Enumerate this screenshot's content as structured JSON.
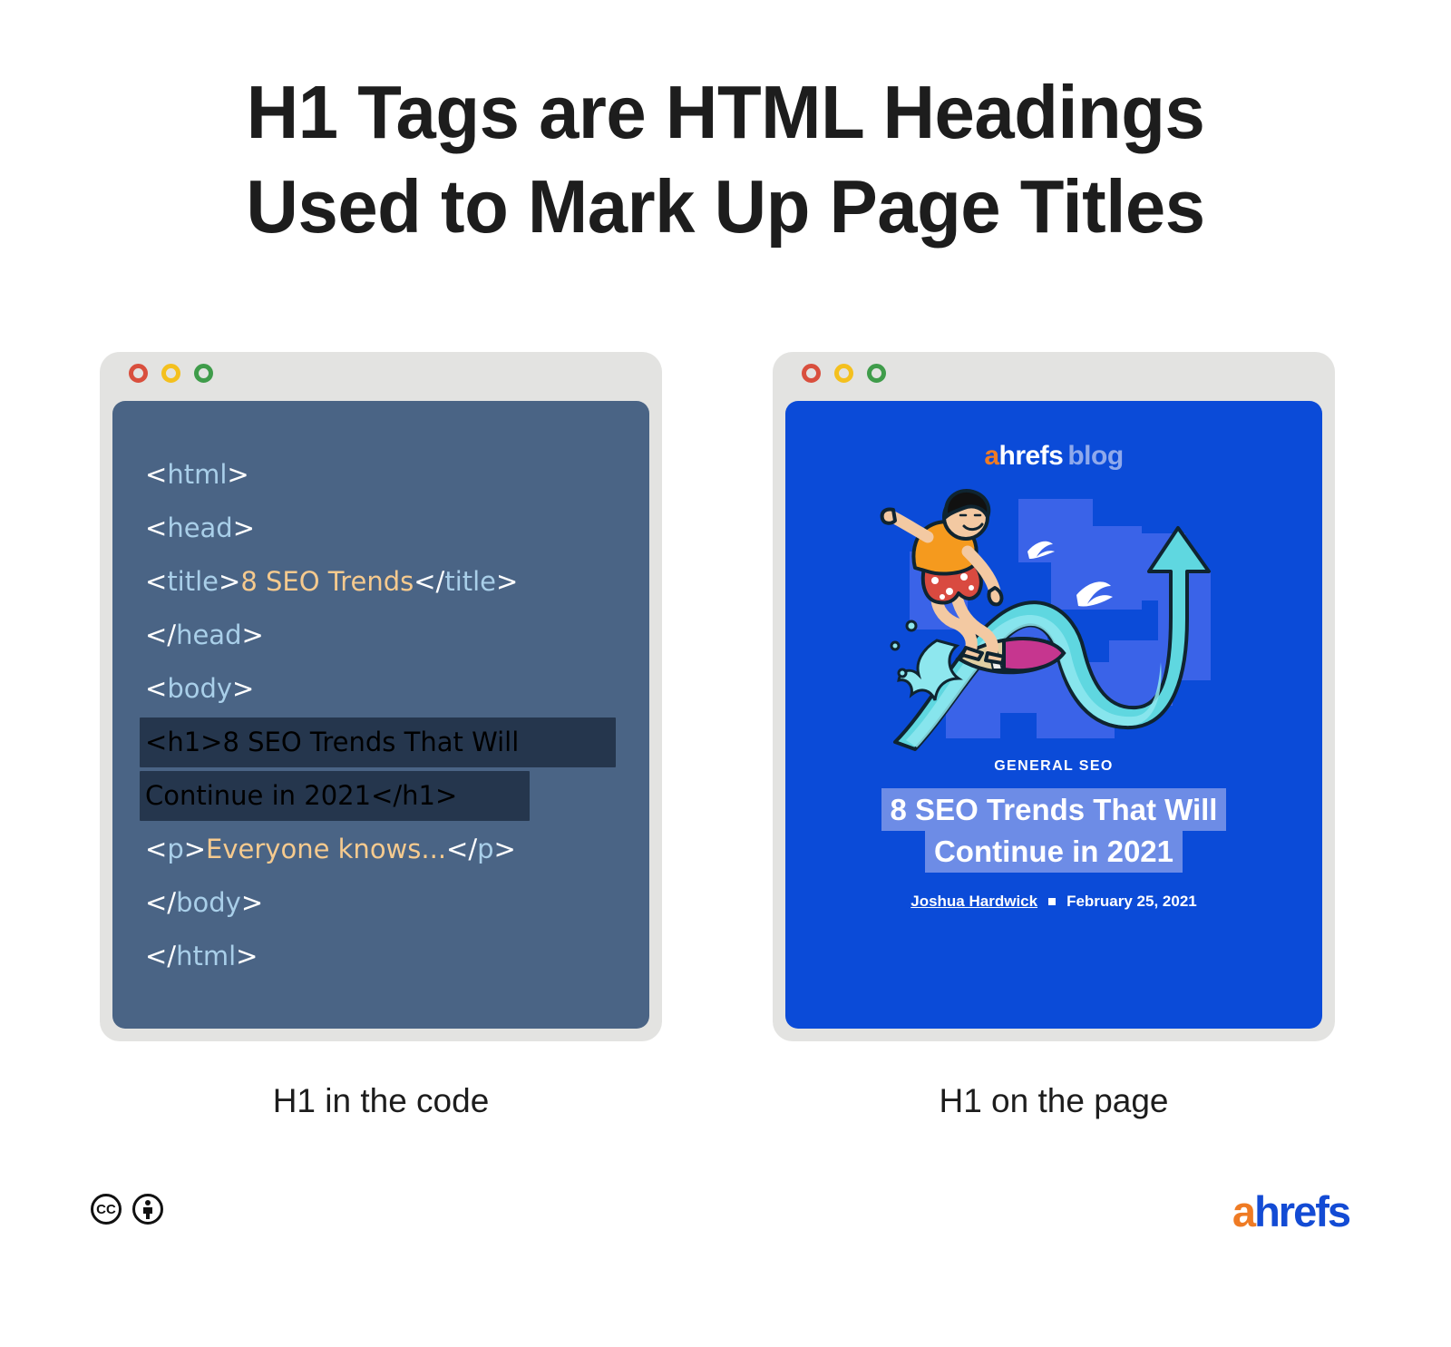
{
  "title": {
    "line1": "H1 Tags are HTML Headings",
    "line2": "Used to Mark Up Page Titles"
  },
  "code_panel": {
    "window_dots": [
      "close-dot-red",
      "minimize-dot-yellow",
      "maximize-dot-green"
    ],
    "caption": "H1 in the code",
    "lines": [
      {
        "id": "line-html-open",
        "highlight": false,
        "parts": [
          {
            "t": "brk",
            "v": "<"
          },
          {
            "t": "tag",
            "v": "html"
          },
          {
            "t": "brk",
            "v": ">"
          }
        ]
      },
      {
        "id": "line-head-open",
        "highlight": false,
        "parts": [
          {
            "t": "brk",
            "v": "<"
          },
          {
            "t": "tag",
            "v": "head"
          },
          {
            "t": "brk",
            "v": ">"
          }
        ]
      },
      {
        "id": "line-title",
        "highlight": false,
        "parts": [
          {
            "t": "brk",
            "v": "<"
          },
          {
            "t": "tag",
            "v": "title"
          },
          {
            "t": "brk",
            "v": ">"
          },
          {
            "t": "txt",
            "v": "8 SEO Trends"
          },
          {
            "t": "brk",
            "v": "</"
          },
          {
            "t": "tag",
            "v": "title"
          },
          {
            "t": "brk",
            "v": ">"
          }
        ]
      },
      {
        "id": "line-head-close",
        "highlight": false,
        "parts": [
          {
            "t": "brk",
            "v": "</"
          },
          {
            "t": "tag",
            "v": "head"
          },
          {
            "t": "brk",
            "v": ">"
          }
        ]
      },
      {
        "id": "line-body-open",
        "highlight": false,
        "parts": [
          {
            "t": "brk",
            "v": "<"
          },
          {
            "t": "tag",
            "v": "body"
          },
          {
            "t": "brk",
            "v": ">"
          }
        ]
      },
      {
        "id": "line-p",
        "highlight": false,
        "parts": [
          {
            "t": "brk",
            "v": "<"
          },
          {
            "t": "tag",
            "v": "p"
          },
          {
            "t": "brk",
            "v": ">"
          },
          {
            "t": "txt",
            "v": "Everyone knows..."
          },
          {
            "t": "brk",
            "v": "</"
          },
          {
            "t": "tag",
            "v": "p"
          },
          {
            "t": "brk",
            "v": ">"
          }
        ]
      },
      {
        "id": "line-body-close",
        "highlight": false,
        "parts": [
          {
            "t": "brk",
            "v": "</"
          },
          {
            "t": "tag",
            "v": "body"
          },
          {
            "t": "brk",
            "v": ">"
          }
        ]
      },
      {
        "id": "line-html-close",
        "highlight": false,
        "parts": [
          {
            "t": "brk",
            "v": "</"
          },
          {
            "t": "tag",
            "v": "html"
          },
          {
            "t": "brk",
            "v": ">"
          }
        ]
      }
    ],
    "highlighted_h1": {
      "row1": [
        {
          "t": "brk",
          "v": "<"
        },
        {
          "t": "tag",
          "v": "h1"
        },
        {
          "t": "brk",
          "v": ">"
        },
        {
          "t": "txt",
          "v": "8 SEO Trends That Will"
        }
      ],
      "row2": [
        {
          "t": "txt",
          "v": "Continue in 2021"
        },
        {
          "t": "brk",
          "v": "</"
        },
        {
          "t": "tag",
          "v": "h1"
        },
        {
          "t": "brk",
          "v": ">"
        }
      ],
      "row1_width": 525,
      "row2_width": 430
    },
    "colors": {
      "frame": "#e3e3e1",
      "editor_bg": "#4a6485",
      "highlight_bg": "#25364d",
      "tag": "#a9cfe9",
      "bracket": "#ffffff",
      "text": "#f6ca8e",
      "dot_red": "#d94f3d",
      "dot_yellow": "#f4c01e",
      "dot_green": "#3f9c4a"
    }
  },
  "page_panel": {
    "caption": "H1 on the page",
    "logo": {
      "a": "a",
      "rest": "hrefs",
      "blog": "blog"
    },
    "category": "GENERAL SEO",
    "headline_line1": "8 SEO Trends That Will",
    "headline_line2": "Continue in 2021",
    "author": "Joshua Hardwick",
    "date": "February 25, 2021",
    "colors": {
      "bg": "#0b4bd8",
      "block": "#3a63e8",
      "highlight": "#6d8ce6",
      "arrow": "#5fd7e0",
      "arrow_light": "#8ee7ee",
      "shirt": "#f59a1e",
      "shorts": "#d94a40",
      "board_pink": "#c6368f",
      "logo_a": "#ef7b24",
      "logo_blog": "#8fa9ec"
    }
  },
  "footer": {
    "cc_badges": [
      "cc",
      "by-person"
    ],
    "brand_a": "a",
    "brand_rest": "hrefs"
  }
}
